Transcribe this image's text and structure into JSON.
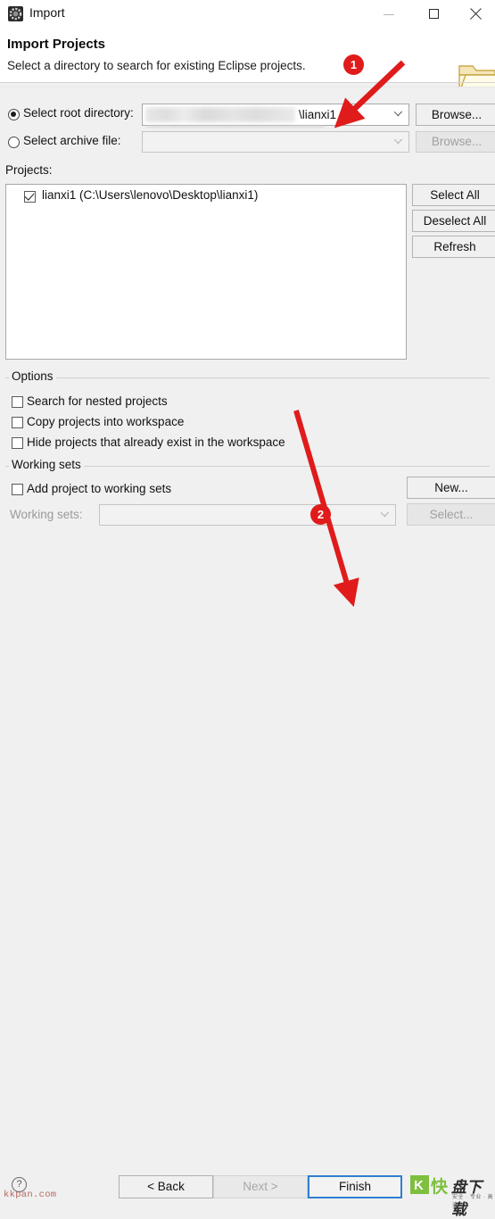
{
  "window": {
    "title": "Import",
    "icon": "eclipse-import-icon",
    "controls": {
      "minimize": "–",
      "maximize": "□",
      "close": "✕"
    }
  },
  "header": {
    "title": "Import Projects",
    "subtitle": "Select a directory to search for existing Eclipse projects.",
    "icon": "open-folder-icon"
  },
  "source": {
    "root_directory": {
      "label": "Select root directory:",
      "selected": true,
      "value": "\\lianxi1",
      "redacted": true,
      "browse_label": "Browse...",
      "browse_enabled": true
    },
    "archive_file": {
      "label": "Select archive file:",
      "selected": false,
      "value": "",
      "browse_label": "Browse...",
      "browse_enabled": false
    }
  },
  "projects": {
    "label": "Projects:",
    "items": [
      {
        "name": "lianxi1 (C:\\Users\\lenovo\\Desktop\\lianxi1)",
        "checked": true
      }
    ],
    "buttons": [
      {
        "label": "Select All",
        "enabled": true
      },
      {
        "label": "Deselect All",
        "enabled": true
      },
      {
        "label": "Refresh",
        "enabled": true
      }
    ]
  },
  "options": {
    "group_label": "Options",
    "items": [
      {
        "label": "Search for nested projects",
        "checked": false
      },
      {
        "label": "Copy projects into workspace",
        "checked": false
      },
      {
        "label": "Hide projects that already exist in the workspace",
        "checked": false
      }
    ]
  },
  "working_sets": {
    "group_label": "Working sets",
    "add_checkbox": {
      "label": "Add project to working sets",
      "checked": false
    },
    "field_label": "Working sets:",
    "field_value": "",
    "field_enabled": false,
    "new_button": {
      "label": "New...",
      "enabled": true
    },
    "select_button": {
      "label": "Select...",
      "enabled": false
    }
  },
  "footer": {
    "help_icon": "?",
    "buttons": [
      {
        "label": "< Back",
        "enabled": true,
        "focused": false
      },
      {
        "label": "Next >",
        "enabled": false,
        "focused": false
      },
      {
        "label": "Finish",
        "enabled": true,
        "focused": true
      }
    ]
  },
  "annotations": {
    "badges": [
      {
        "text": "1"
      },
      {
        "text": "2"
      }
    ],
    "color": "#e01b1b",
    "arrows": 2
  },
  "watermarks": {
    "left": "kkpan.com",
    "right_mark": "K",
    "right_text_1": "快",
    "right_text_2": "盘下载",
    "right_text_3": "安全 · 专业 · 高速"
  }
}
